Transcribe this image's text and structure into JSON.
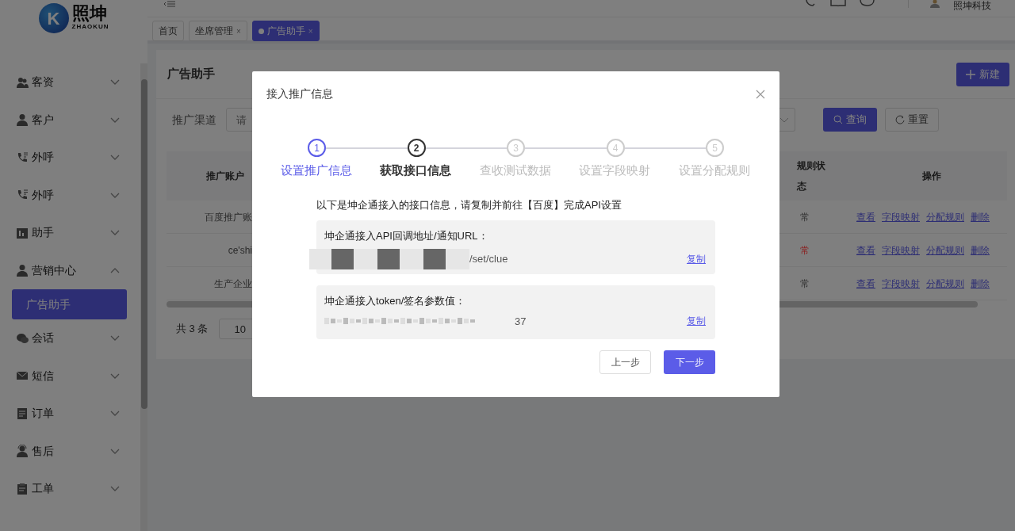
{
  "logo": {
    "mark": "K",
    "name": "照坤",
    "subtitle": "ZHAOKUN"
  },
  "sidebar": {
    "items": [
      {
        "label": "客资",
        "expanded": false
      },
      {
        "label": "客户",
        "expanded": false
      },
      {
        "label": "外呼",
        "expanded": false
      },
      {
        "label": "外呼",
        "expanded": false
      },
      {
        "label": "助手",
        "expanded": false
      },
      {
        "label": "营销中心",
        "expanded": true,
        "children": [
          {
            "label": "广告助手",
            "selected": true
          }
        ]
      },
      {
        "label": "会话",
        "expanded": false
      },
      {
        "label": "短信",
        "expanded": false
      },
      {
        "label": "订单",
        "expanded": false
      },
      {
        "label": "售后",
        "expanded": false
      },
      {
        "label": "工单",
        "expanded": false
      }
    ]
  },
  "header": {
    "user": "照坤科技"
  },
  "tabs": [
    {
      "label": "首页",
      "closable": false,
      "selected": false
    },
    {
      "label": "坐席管理",
      "closable": true,
      "selected": false
    },
    {
      "label": "广告助手",
      "closable": true,
      "selected": true
    }
  ],
  "close_mark": "×",
  "page": {
    "title": "广告助手",
    "new_button": "新建",
    "filter": {
      "label": "推广渠道",
      "placeholder": "请",
      "search_button": "查询",
      "reset_button": "重置"
    },
    "table": {
      "columns": [
        "推广账户",
        "规则状态",
        "操作"
      ],
      "rows": [
        {
          "account": "百度推广账",
          "status": "常",
          "color": "#333333",
          "actions": [
            "查看",
            "字段映射",
            "分配规则",
            "删除"
          ]
        },
        {
          "account": "ce'shi",
          "status": "常",
          "color": "#8b2020",
          "actions": [
            "查看",
            "字段映射",
            "分配规则",
            "删除"
          ]
        },
        {
          "account": "生产企业",
          "status": "常",
          "color": "#333333",
          "actions": [
            "查看",
            "字段映射",
            "分配规则",
            "删除"
          ]
        }
      ]
    },
    "pagination": {
      "total": "共 3 条",
      "page_size": "10"
    }
  },
  "modal": {
    "title": "接入推广信息",
    "steps": [
      {
        "number": "1",
        "label": "设置推广信息",
        "done": true,
        "selected": false
      },
      {
        "number": "2",
        "label": "获取接口信息",
        "done": false,
        "selected": true
      },
      {
        "number": "3",
        "label": "查收测试数据",
        "done": false,
        "selected": false
      },
      {
        "number": "4",
        "label": "设置字段映射",
        "done": false,
        "selected": false
      },
      {
        "number": "5",
        "label": "设置分配规则",
        "done": false,
        "selected": false
      }
    ],
    "intro": "以下是坤企通接入的接口信息，请复制并前往【百度】完成API设置",
    "fields": [
      {
        "label": "坤企通接入API回调地址/通知URL：",
        "value": "/set/clue",
        "kind": "masked",
        "copy": "复制"
      },
      {
        "label": "坤企通接入token/签名参数值：",
        "value": "37",
        "kind": "blurred",
        "copy": "复制"
      }
    ],
    "buttons": [
      {
        "label": "上一步",
        "primary": false
      },
      {
        "label": "下一步",
        "primary": true
      }
    ]
  }
}
